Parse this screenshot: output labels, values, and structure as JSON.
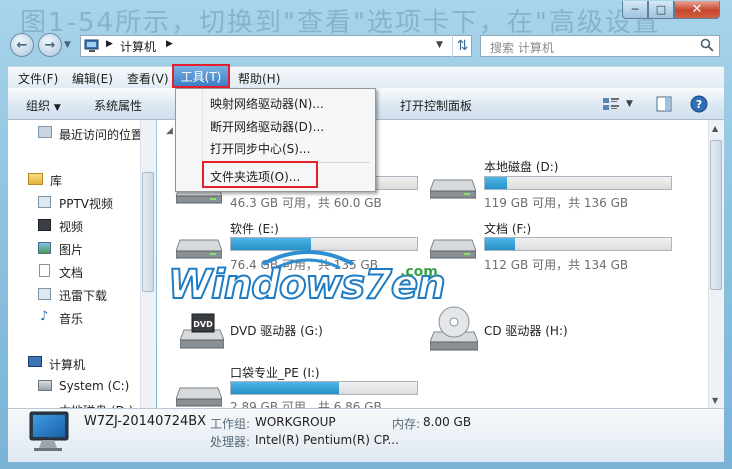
{
  "address": {
    "path": "计算机",
    "search_placeholder": "搜索 计算机"
  },
  "menubar": [
    {
      "label": "文件(F)"
    },
    {
      "label": "编辑(E)"
    },
    {
      "label": "查看(V)"
    },
    {
      "label": "工具(T)",
      "active": true
    },
    {
      "label": "帮助(H)"
    }
  ],
  "toolbar": {
    "organize": "组织",
    "system_properties": "系统属性",
    "open_control_panel": "打开控制面板"
  },
  "tools_menu": [
    {
      "label": "映射网络驱动器(N)..."
    },
    {
      "label": "断开网络驱动器(D)..."
    },
    {
      "label": "打开同步中心(S)..."
    },
    {
      "label": "文件夹选项(O)...",
      "highlighted": true
    }
  ],
  "sidebar": {
    "recent": "最近访问的位置",
    "library": "库",
    "items": [
      "PPTV视频",
      "视频",
      "图片",
      "文档",
      "迅雷下载",
      "音乐"
    ],
    "computer": "计算机",
    "computer_items": [
      "System (C:)",
      "本地磁盘 (D:)"
    ]
  },
  "drives": [
    {
      "name": "",
      "info": "46.3 GB 可用，共 60.0 GB",
      "used_fraction": 0.23
    },
    {
      "name": "本地磁盘 (D:)",
      "info": "119 GB 可用，共 136 GB",
      "used_fraction": 0.12
    },
    {
      "name": "软件 (E:)",
      "info": "76.4 GB 可用，共 135 GB",
      "used_fraction": 0.43
    },
    {
      "name": "文档 (F:)",
      "info": "112 GB 可用，共 134 GB",
      "used_fraction": 0.16
    },
    {
      "name": "DVD 驱动器 (G:)"
    },
    {
      "name": "CD 驱动器 (H:)"
    },
    {
      "name": "口袋专业_PE (I:)",
      "info": "2.89 GB 可用，共 6.86 GB",
      "used_fraction": 0.58
    }
  ],
  "watermark": {
    "text": "Windows7en",
    "suffix": ".com"
  },
  "details": {
    "name": "W7ZJ-20140724BX",
    "workgroup_label": "工作组:",
    "workgroup": "WORKGROUP",
    "memory_label": "内存:",
    "memory": "8.00 GB",
    "cpu_label": "处理器:",
    "cpu": "Intel(R) Pentium(R) CP..."
  },
  "colors": {
    "accent": "#3b7fc7",
    "highlight_box": "#e5202d",
    "bar_fill": "#2690c8"
  }
}
